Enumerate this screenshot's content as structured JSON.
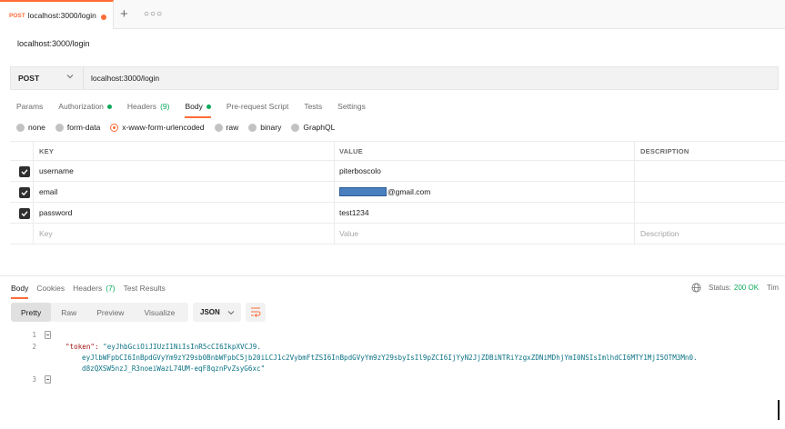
{
  "tab": {
    "method": "POST",
    "title": "localhost:3000/login"
  },
  "request": {
    "title": "localhost:3000/login",
    "method": "POST",
    "url": "localhost:3000/login"
  },
  "request_tabs": [
    {
      "label": "Params"
    },
    {
      "label": "Authorization"
    },
    {
      "label": "Headers",
      "count": "(9)"
    },
    {
      "label": "Body"
    },
    {
      "label": "Pre-request Script"
    },
    {
      "label": "Tests"
    },
    {
      "label": "Settings"
    }
  ],
  "body_types": [
    "none",
    "form-data",
    "x-www-form-urlencoded",
    "raw",
    "binary",
    "GraphQL"
  ],
  "params": {
    "headers": {
      "key": "KEY",
      "value": "VALUE",
      "description": "DESCRIPTION"
    },
    "rows": [
      {
        "key": "username",
        "value": "piterboscolo"
      },
      {
        "key": "email",
        "value": "@gmail.com"
      },
      {
        "key": "password",
        "value": "test1234"
      }
    ],
    "placeholder": {
      "key": "Key",
      "value": "Value",
      "description": "Description"
    }
  },
  "response_tabs": [
    {
      "label": "Body"
    },
    {
      "label": "Cookies"
    },
    {
      "label": "Headers",
      "count": "(7)"
    },
    {
      "label": "Test Results"
    }
  ],
  "status": {
    "label": "Status:",
    "value": "200 OK",
    "time": "Tim"
  },
  "view_modes": [
    "Pretty",
    "Raw",
    "Preview",
    "Visualize"
  ],
  "format": "JSON",
  "code": {
    "line_numbers": [
      "1",
      "2",
      "3"
    ],
    "key": "\"token\":",
    "token_line1": "\"eyJhbGciOiJIUzI1NiIsInR5cCI6IkpXVCJ9.",
    "token_line2": "eyJlbWFpbCI6InBpdGVyYm9zY29sb0BnbWFpbC5jb20iLCJ1c2VybmFtZSI6InBpdGVyYm9zY29sbyIsIl9pZCI6IjYyN2JjZDBiNTRiYzgxZDNiMDhjYmI0NSIsImlhdCI6MTY1MjI5OTM3Mn0.",
    "token_line3": "d8zQXSW5nzJ_R3noeiWazL74UM-eqF8qznPvZsyG6xc\""
  }
}
